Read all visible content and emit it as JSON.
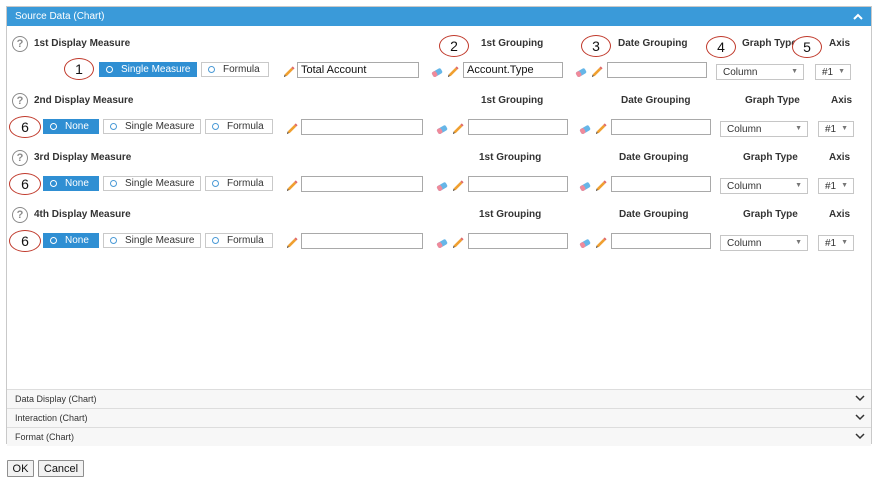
{
  "header": {
    "title": "Source Data (Chart)"
  },
  "labels": {
    "first_grouping": "1st Grouping",
    "date_grouping": "Date Grouping",
    "graph_type": "Graph Type",
    "axis": "Axis",
    "help": "?"
  },
  "options": {
    "none": "None",
    "single_measure": "Single Measure",
    "formula": "Formula"
  },
  "measures": [
    {
      "title": "1st Display Measure",
      "measure_value": "Total Account",
      "grouping_value": "Account.Type",
      "date_grouping_value": "",
      "graph_type": "Column",
      "axis": "#1"
    },
    {
      "title": "2nd Display Measure",
      "measure_value": "",
      "grouping_value": "",
      "date_grouping_value": "",
      "graph_type": "Column",
      "axis": "#1"
    },
    {
      "title": "3rd Display Measure",
      "measure_value": "",
      "grouping_value": "",
      "date_grouping_value": "",
      "graph_type": "Column",
      "axis": "#1"
    },
    {
      "title": "4th Display Measure",
      "measure_value": "",
      "grouping_value": "",
      "date_grouping_value": "",
      "graph_type": "Column",
      "axis": "#1"
    }
  ],
  "callouts": [
    "1",
    "2",
    "3",
    "4",
    "5",
    "6",
    "6",
    "6"
  ],
  "collapsed_sections": [
    {
      "label": "Data Display (Chart)"
    },
    {
      "label": "Interaction (Chart)"
    },
    {
      "label": "Format (Chart)"
    }
  ],
  "buttons": {
    "ok": "OK",
    "cancel": "Cancel"
  },
  "colors": {
    "header": "#3a9ad9",
    "active_option": "#2f8fd3",
    "callout": "#c0392b"
  }
}
